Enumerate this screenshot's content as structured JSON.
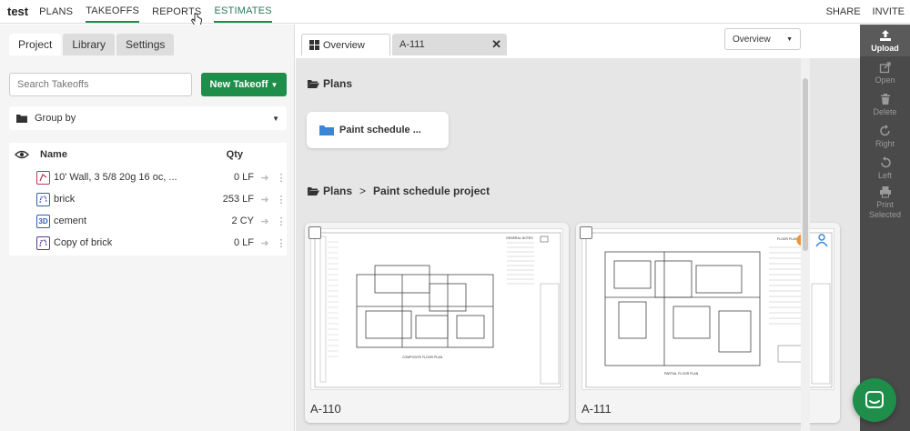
{
  "app": {
    "title": "test"
  },
  "nav": {
    "items": [
      {
        "label": "PLANS"
      },
      {
        "label": "TAKEOFFS"
      },
      {
        "label": "REPORTS"
      },
      {
        "label": "ESTIMATES"
      }
    ],
    "right": [
      {
        "label": "SHARE"
      },
      {
        "label": "INVITE"
      }
    ]
  },
  "left": {
    "tabs": [
      {
        "label": "Project"
      },
      {
        "label": "Library"
      },
      {
        "label": "Settings"
      }
    ],
    "search_placeholder": "Search Takeoffs",
    "new_takeoff_label": "New Takeoff",
    "group_by_label": "Group by",
    "table": {
      "headers": {
        "name": "Name",
        "qty": "Qty"
      },
      "rows": [
        {
          "icon_text": "",
          "name": "10' Wall, 3 5/8 20g 16 oc, ...",
          "qty": "0 LF",
          "icon_color": "#b23b5c"
        },
        {
          "icon_text": "",
          "name": "brick",
          "qty": "253 LF",
          "icon_color": "#3b5ca8"
        },
        {
          "icon_text": "3D",
          "name": "cement",
          "qty": "2 CY",
          "icon_color": "#2d5fb0"
        },
        {
          "icon_text": "",
          "name": "Copy of brick",
          "qty": "0 LF",
          "icon_color": "#5a3b8c"
        }
      ]
    }
  },
  "center": {
    "tabs": [
      {
        "label": "Overview"
      },
      {
        "label": "A-111"
      }
    ],
    "view_select": "Overview",
    "plans_section": "Plans",
    "folder_name": "Paint schedule ...",
    "breadcrumb": [
      "Plans",
      "Paint schedule project"
    ],
    "breadcrumb_sep": ">",
    "sheets": [
      {
        "label": "A-110",
        "drawing_title": "COMPOSITE FLOOR PLAN",
        "notes_title": "GENERAL NOTES"
      },
      {
        "label": "A-111",
        "drawing_title": "PARTIAL FLOOR PLAN",
        "notes_title": "FLOOR PLAN"
      }
    ]
  },
  "rail": {
    "tools": [
      {
        "label": "Upload",
        "icon": "upload-icon"
      },
      {
        "label": "Open",
        "icon": "open-icon"
      },
      {
        "label": "Delete",
        "icon": "trash-icon"
      },
      {
        "label": "Right",
        "icon": "rotate-right-icon"
      },
      {
        "label": "Left",
        "icon": "rotate-left-icon"
      },
      {
        "label": "Print Selected",
        "icon": "print-icon"
      }
    ]
  },
  "colors": {
    "brand_green": "#1e8e4a",
    "rail_bg": "#4a4a4a",
    "folder_blue": "#3a86d6"
  }
}
